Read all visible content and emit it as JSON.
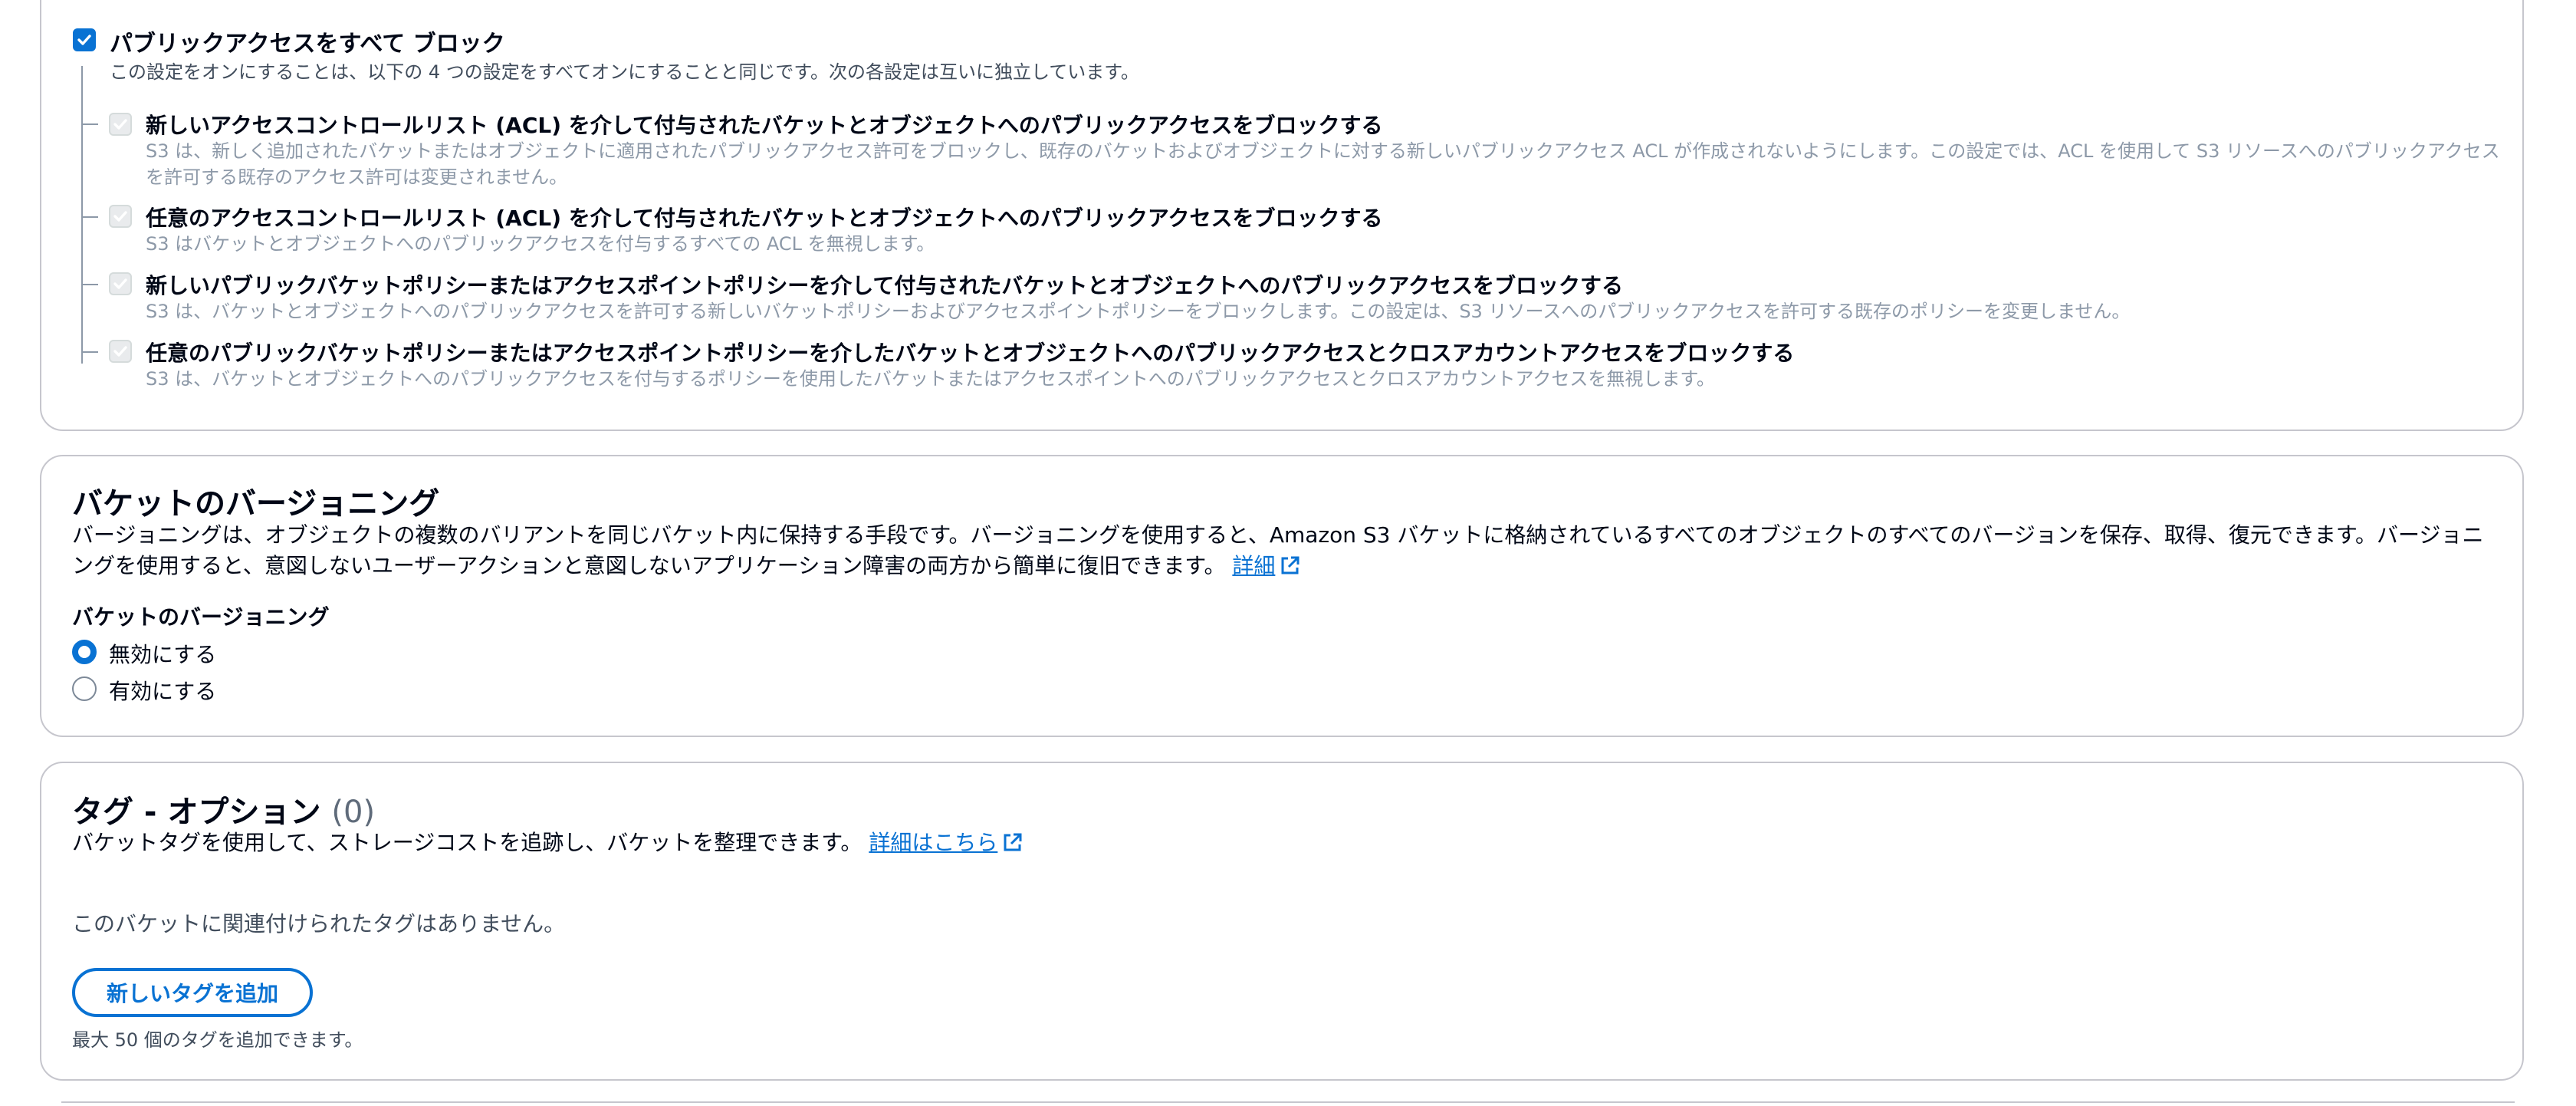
{
  "block_public_access": {
    "main": {
      "label": "パブリックアクセスをすべて ブロック",
      "description": "この設定をオンにすることは、以下の 4 つの設定をすべてオンにすることと同じです。次の各設定は互いに独立しています。",
      "checked": true
    },
    "options": [
      {
        "label": "新しいアクセスコントロールリスト (ACL) を介して付与されたバケットとオブジェクトへのパブリックアクセスをブロックする",
        "description": "S3 は、新しく追加されたバケットまたはオブジェクトに適用されたパブリックアクセス許可をブロックし、既存のバケットおよびオブジェクトに対する新しいパブリックアクセス ACL が作成されないようにします。この設定では、ACL を使用して S3 リソースへのパブリックアクセスを許可する既存のアクセス許可は変更されません。"
      },
      {
        "label": "任意のアクセスコントロールリスト (ACL) を介して付与されたバケットとオブジェクトへのパブリックアクセスをブロックする",
        "description": "S3 はバケットとオブジェクトへのパブリックアクセスを付与するすべての ACL を無視します。"
      },
      {
        "label": "新しいパブリックバケットポリシーまたはアクセスポイントポリシーを介して付与されたバケットとオブジェクトへのパブリックアクセスをブロックする",
        "description": "S3 は、バケットとオブジェクトへのパブリックアクセスを許可する新しいバケットポリシーおよびアクセスポイントポリシーをブロックします。この設定は、S3 リソースへのパブリックアクセスを許可する既存のポリシーを変更しません。"
      },
      {
        "label": "任意のパブリックバケットポリシーまたはアクセスポイントポリシーを介したバケットとオブジェクトへのパブリックアクセスとクロスアカウントアクセスをブロックする",
        "description": "S3 は、バケットとオブジェクトへのパブリックアクセスを付与するポリシーを使用したバケットまたはアクセスポイントへのパブリックアクセスとクロスアカウントアクセスを無視します。"
      }
    ]
  },
  "versioning": {
    "title": "バケットのバージョニング",
    "description": "バージョニングは、オブジェクトの複数のバリアントを同じバケット内に保持する手段です。バージョニングを使用すると、Amazon S3 バケットに格納されているすべてのオブジェクトのすべてのバージョンを保存、取得、復元できます。バージョニングを使用すると、意図しないユーザーアクションと意図しないアプリケーション障害の両方から簡単に復旧できます。",
    "learn_more": "詳細",
    "field_label": "バケットのバージョニング",
    "options": [
      "無効にする",
      "有効にする"
    ],
    "selected": "無効にする"
  },
  "tags": {
    "title": "タグ - オプション",
    "count": "(0)",
    "description": "バケットタグを使用して、ストレージコストを追跡し、バケットを整理できます。",
    "learn_more": "詳細はこちら",
    "empty_text": "このバケットに関連付けられたタグはありません。",
    "add_button": "新しいタグを追加",
    "hint": "最大 50 個のタグを追加できます。"
  },
  "colors": {
    "primary": "#0972d3",
    "border": "#c6c6cd",
    "disabled_text": "#8d99a8"
  }
}
